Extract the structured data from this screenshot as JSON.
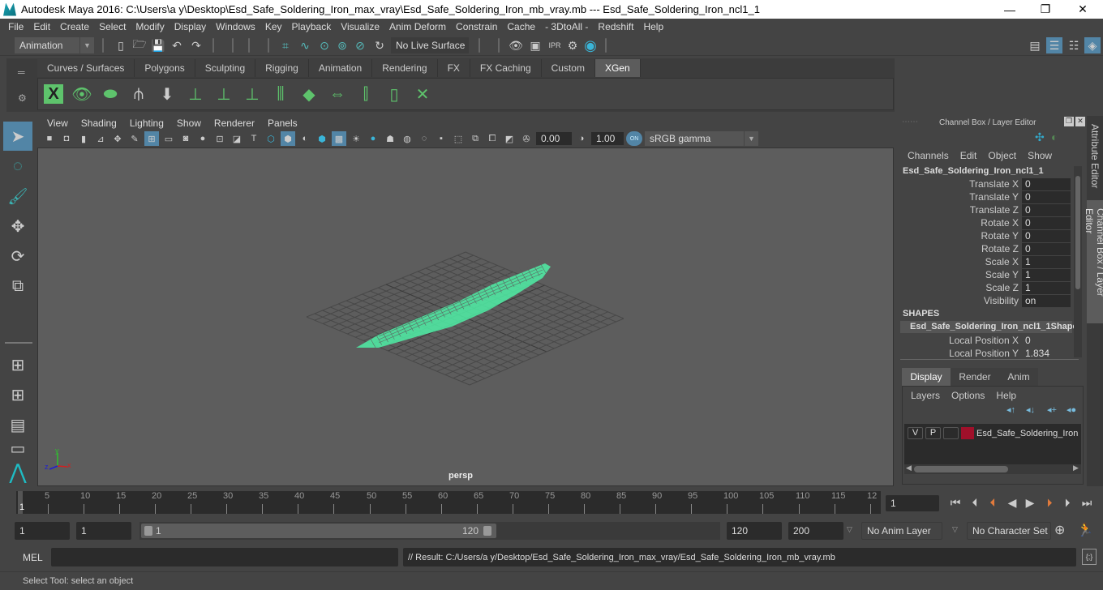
{
  "window": {
    "title": "Autodesk Maya 2016: C:\\Users\\a y\\Desktop\\Esd_Safe_Soldering_Iron_max_vray\\Esd_Safe_Soldering_Iron_mb_vray.mb  ---  Esd_Safe_Soldering_Iron_ncl1_1",
    "minimize": "—",
    "maximize": "❐",
    "close": "✕"
  },
  "menubar": [
    "File",
    "Edit",
    "Create",
    "Select",
    "Modify",
    "Display",
    "Windows",
    "Key",
    "Playback",
    "Visualize",
    "Anim Deform",
    "Constrain",
    "Cache",
    "- 3DtoAll -",
    "Redshift",
    "Help"
  ],
  "statusline": {
    "mode": "Animation",
    "live_surface": "No Live Surface"
  },
  "shelf": {
    "tabs": [
      "Curves / Surfaces",
      "Polygons",
      "Sculpting",
      "Rigging",
      "Animation",
      "Rendering",
      "FX",
      "FX Caching",
      "Custom",
      "XGen"
    ],
    "active_tab": "XGen",
    "icons": [
      "xgen-window-icon",
      "preview-icon",
      "clear-preview-icon",
      "add-guides-icon",
      "place-guides-icon",
      "add-guide-icon",
      "show-guide-icon",
      "lock-guide-icon",
      "split-guide-icon",
      "collection-icon",
      "guide-transfer-icon",
      "select-guides-icon",
      "bound-guides-icon",
      "delete-guides-icon"
    ]
  },
  "panel": {
    "menus": [
      "View",
      "Shading",
      "Lighting",
      "Show",
      "Renderer",
      "Panels"
    ],
    "exposure": "0.00",
    "gamma": "1.00",
    "color_mgmt_badge": "ON",
    "color_space": "sRGB gamma",
    "camera_label": "persp"
  },
  "axis": {
    "x": "x",
    "y": "y",
    "z": "z"
  },
  "channelbox": {
    "header": "Channel Box / Layer Editor",
    "menus": [
      "Channels",
      "Edit",
      "Object",
      "Show"
    ],
    "object_name": "Esd_Safe_Soldering_Iron_ncl1_1",
    "channels": [
      {
        "label": "Translate X",
        "value": "0"
      },
      {
        "label": "Translate Y",
        "value": "0"
      },
      {
        "label": "Translate Z",
        "value": "0"
      },
      {
        "label": "Rotate X",
        "value": "0"
      },
      {
        "label": "Rotate Y",
        "value": "0"
      },
      {
        "label": "Rotate Z",
        "value": "0"
      },
      {
        "label": "Scale X",
        "value": "1"
      },
      {
        "label": "Scale Y",
        "value": "1"
      },
      {
        "label": "Scale Z",
        "value": "1"
      },
      {
        "label": "Visibility",
        "value": "on"
      }
    ],
    "shapes_header": "SHAPES",
    "shape_name": "Esd_Safe_Soldering_Iron_ncl1_1Shape",
    "shape_channels": [
      {
        "label": "Local Position X",
        "value": "0"
      },
      {
        "label": "Local Position Y",
        "value": "1.834"
      }
    ]
  },
  "layereditor": {
    "tabs": [
      "Display",
      "Render",
      "Anim"
    ],
    "active_tab": "Display",
    "menus": [
      "Layers",
      "Options",
      "Help"
    ],
    "layers": [
      {
        "v": "V",
        "p": "P",
        "color": "#a0102a",
        "name": "Esd_Safe_Soldering_Iron"
      }
    ]
  },
  "sidetabs": {
    "attribute_editor": "Attribute Editor",
    "channel_box": "Channel Box / Layer Editor"
  },
  "timeline": {
    "ticks": [
      "5",
      "10",
      "15",
      "20",
      "25",
      "30",
      "35",
      "40",
      "45",
      "50",
      "55",
      "60",
      "65",
      "70",
      "75",
      "80",
      "85",
      "90",
      "95",
      "100",
      "105",
      "110",
      "115",
      "12"
    ],
    "current_frame_marker": "1",
    "current_frame": "1"
  },
  "range": {
    "start": "1",
    "anim_start": "1",
    "slider_min": "1",
    "slider_max": "120",
    "anim_end": "120",
    "end": "200",
    "anim_layer": "No Anim Layer",
    "character_set": "No Character Set"
  },
  "mel": {
    "label": "MEL",
    "input": "",
    "result": "// Result: C:/Users/a y/Desktop/Esd_Safe_Soldering_Iron_max_vray/Esd_Safe_Soldering_Iron_mb_vray.mb"
  },
  "help_line": "Select Tool: select an object",
  "colors": {
    "accent": "#5285a6",
    "wireframe": "#4fefa6",
    "xgen_green": "#5ec36c",
    "key_orange": "#e07a3c"
  }
}
